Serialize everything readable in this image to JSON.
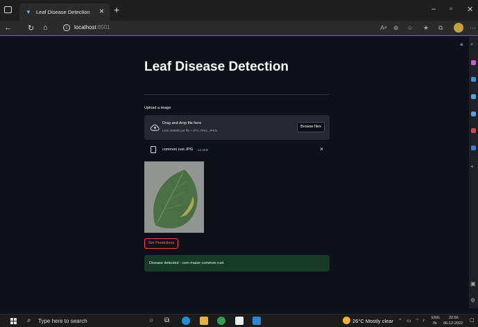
{
  "browser": {
    "tab_title": "Leaf Disease Detection",
    "tab_close": "×",
    "new_tab": "+",
    "min": "–",
    "restore": "▫",
    "close": "✕",
    "url_host": "localhost",
    "url_port": ":8501",
    "reader_label": "Aᵃ",
    "more": "···"
  },
  "app": {
    "title": "Leaf Disease Detection",
    "uploader_label": "Upload a image",
    "dropzone_main": "Drag and drop file here",
    "dropzone_limit": "Limit 200MB per file • JPG, PNG, JPEG",
    "browse_label": "Browse files",
    "file_name": "common rust.JPG",
    "file_size": "14.0KB",
    "file_remove": "×",
    "predict_label": "Get Predictions",
    "result_text": "Disease detected : corn maize common rust"
  },
  "taskbar": {
    "search_placeholder": "Type here to search",
    "weather": "26°C  Mostly clear",
    "lang_top": "ENG",
    "lang_bottom": "IN",
    "time": "22:56",
    "date": "06-12-2022"
  },
  "colors": {
    "page_bg": "#0e1117",
    "accent": "#ff4b4b",
    "success_bg": "#173928",
    "dropzone_bg": "#262730"
  }
}
